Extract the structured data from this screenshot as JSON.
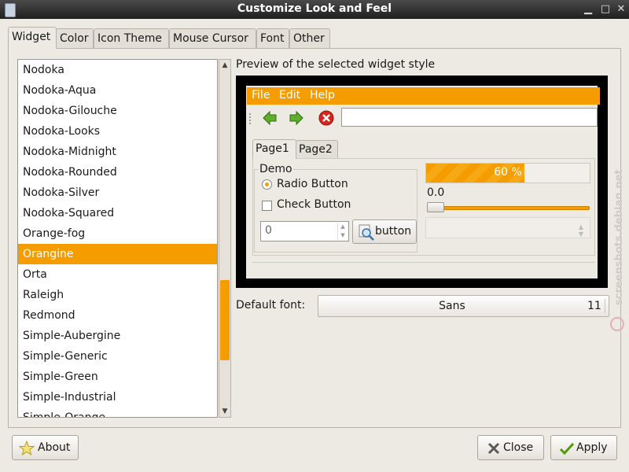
{
  "window": {
    "title": "Customize Look and Feel"
  },
  "tabs": [
    {
      "label": "Widget",
      "active": true
    },
    {
      "label": "Color",
      "active": false
    },
    {
      "label": "Icon Theme",
      "active": false
    },
    {
      "label": "Mouse Cursor",
      "active": false
    },
    {
      "label": "Font",
      "active": false
    },
    {
      "label": "Other",
      "active": false
    }
  ],
  "theme_list": {
    "items": [
      "Nodoka",
      "Nodoka-Aqua",
      "Nodoka-Gilouche",
      "Nodoka-Looks",
      "Nodoka-Midnight",
      "Nodoka-Rounded",
      "Nodoka-Silver",
      "Nodoka-Squared",
      "Orange-fog",
      "Orangine",
      "Orta",
      "Raleigh",
      "Redmond",
      "Simple-Aubergine",
      "Simple-Generic",
      "Simple-Green",
      "Simple-Industrial",
      "Simple-Orange"
    ],
    "selected": "Orangine"
  },
  "preview": {
    "label": "Preview of the selected widget style",
    "menu": [
      "File",
      "Edit",
      "Help"
    ],
    "tabs": [
      "Page1",
      "Page2"
    ],
    "demo_label": "Demo",
    "radio_label": "Radio Button",
    "check_label": "Check Button",
    "spin_value": "0",
    "button_label": "button",
    "progress_text": "60 %",
    "progress_fraction": 0.6,
    "slider_value": "0.0"
  },
  "font": {
    "label": "Default font:",
    "name": "Sans",
    "size": "11"
  },
  "buttons": {
    "about": "About",
    "close": "Close",
    "apply": "Apply"
  },
  "colors": {
    "accent": "#f59d00",
    "titlebar": "#2a2a2a"
  },
  "watermark": "screenshots.debian.net"
}
